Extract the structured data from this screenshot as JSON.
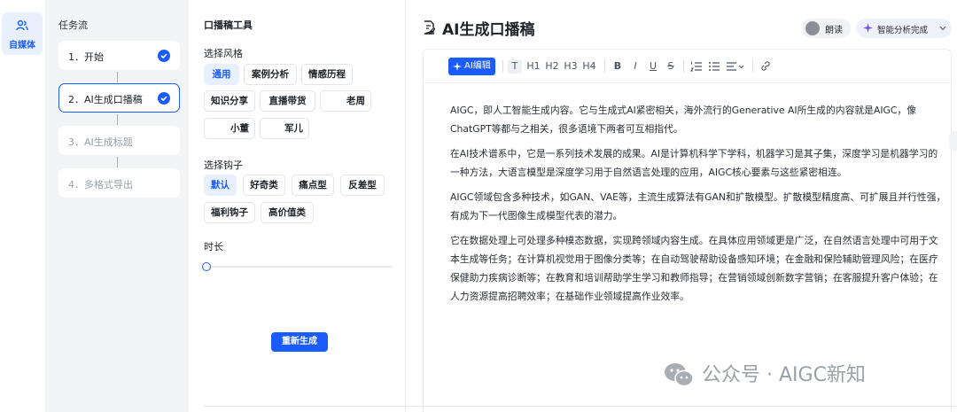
{
  "nav": {
    "label": "自媒体",
    "icon": "user-group-icon"
  },
  "taskflow": {
    "title": "任务流",
    "steps": [
      {
        "label": "1．开始",
        "status": "done"
      },
      {
        "label": "2．AI生成口播稿",
        "status": "active"
      },
      {
        "label": "3．AI生成标题",
        "status": "todo"
      },
      {
        "label": "4．多格式导出",
        "status": "todo"
      }
    ]
  },
  "config": {
    "title": "口播稿工具",
    "style_label": "选择风格",
    "styles": [
      "通用",
      "案例分析",
      "情感历程",
      "知识分享",
      "直播带货",
      "老周",
      "小董",
      "军儿"
    ],
    "selected_style": "通用",
    "hook_label": "选择钩子",
    "hooks": [
      "默认",
      "好奇类",
      "痛点型",
      "反差型",
      "福利钩子",
      "高价值类"
    ],
    "selected_hook": "默认",
    "duration_label": "时长",
    "duration_value": 0,
    "regenerate_label": "重新生成"
  },
  "editor": {
    "title": "AI生成口播稿",
    "read_label": "朗读",
    "analysis_label": "智能分析完成",
    "ai_edit_label": "AI编辑",
    "toolbar": [
      "T",
      "H1",
      "H2",
      "H3",
      "H4",
      "B",
      "I",
      "U",
      "S"
    ],
    "paragraphs": [
      "AIGC，即人工智能生成内容。它与生成式AI紧密相关，海外流行的Generative AI所生成的内容就是AIGC，像ChatGPT等都与之相关，很多语境下两者可互相指代。",
      "在AI技术谱系中，它是一系列技术发展的成果。AI是计算机科学下学科，机器学习是其子集，深度学习是机器学习的一种方法，大语言模型是深度学习用于自然语言处理的应用，AIGC核心要素与这些紧密相连。",
      "AIGC领域包含多种技术，如GAN、VAE等，主流生成算法有GAN和扩散模型。扩散模型精度高、可扩展且并行性强，有成为下一代图像生成模型代表的潜力。",
      "它在数据处理上可处理多种模态数据，实现跨领域内容生成。在具体应用领域更是广泛，在自然语言处理中可用于文本生成等任务；在计算机视觉用于图像分类等；在自动驾驶帮助设备感知环境；在金融和保险辅助管理风险；在医疗保健助力疾病诊断等；在教育和培训帮助学生学习和教师指导；在营销领域创新数字营销；在客服提升客户体验；在人力资源提高招聘效率；在基础作业领域提高作业效率。"
    ]
  },
  "watermark": "公众号 · AIGC新知",
  "colors": {
    "accent": "#1a5cff",
    "selected_bg": "#e8f0fe",
    "panel_bg": "#f3f4f6"
  }
}
